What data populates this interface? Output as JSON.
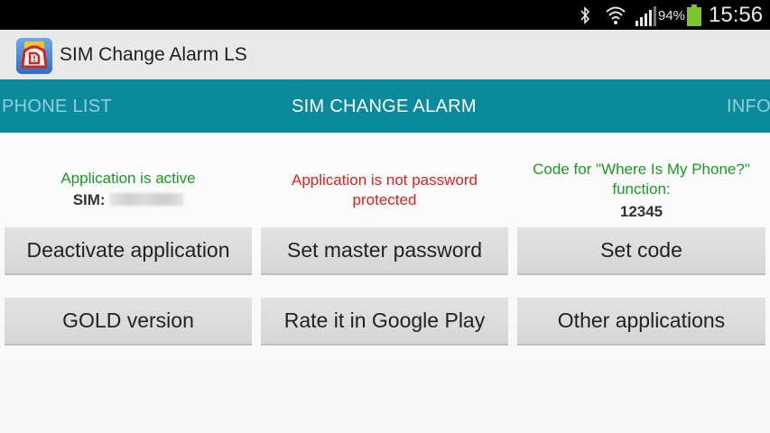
{
  "status_bar": {
    "battery_percent": "94%",
    "time": "15:56",
    "icons": [
      "bluetooth-icon",
      "wifi-icon",
      "signal-icon",
      "battery-icon"
    ],
    "battery_level": 0.94
  },
  "app": {
    "title": "SIM Change Alarm LS",
    "icon": "app-alarm-icon"
  },
  "tabs": [
    {
      "label": "PHONE LIST",
      "active": false
    },
    {
      "label": "SIM CHANGE ALARM",
      "active": true
    },
    {
      "label": "INFO",
      "active": false
    }
  ],
  "status": {
    "active_text": "Application is active",
    "sim_label": "SIM:",
    "password_text": "Application is not password protected",
    "code_text": "Code for \"Where Is My Phone?\" function:",
    "code_value": "12345"
  },
  "buttons": {
    "deactivate": "Deactivate application",
    "set_master_password": "Set master password",
    "set_code": "Set code",
    "gold_version": "GOLD version",
    "rate": "Rate it in Google Play",
    "other_apps": "Other applications"
  },
  "colors": {
    "tab_bar": "#0b8a9c",
    "status_ok": "#1a9a23",
    "status_warn": "#e0201e",
    "button": "#dadada"
  }
}
